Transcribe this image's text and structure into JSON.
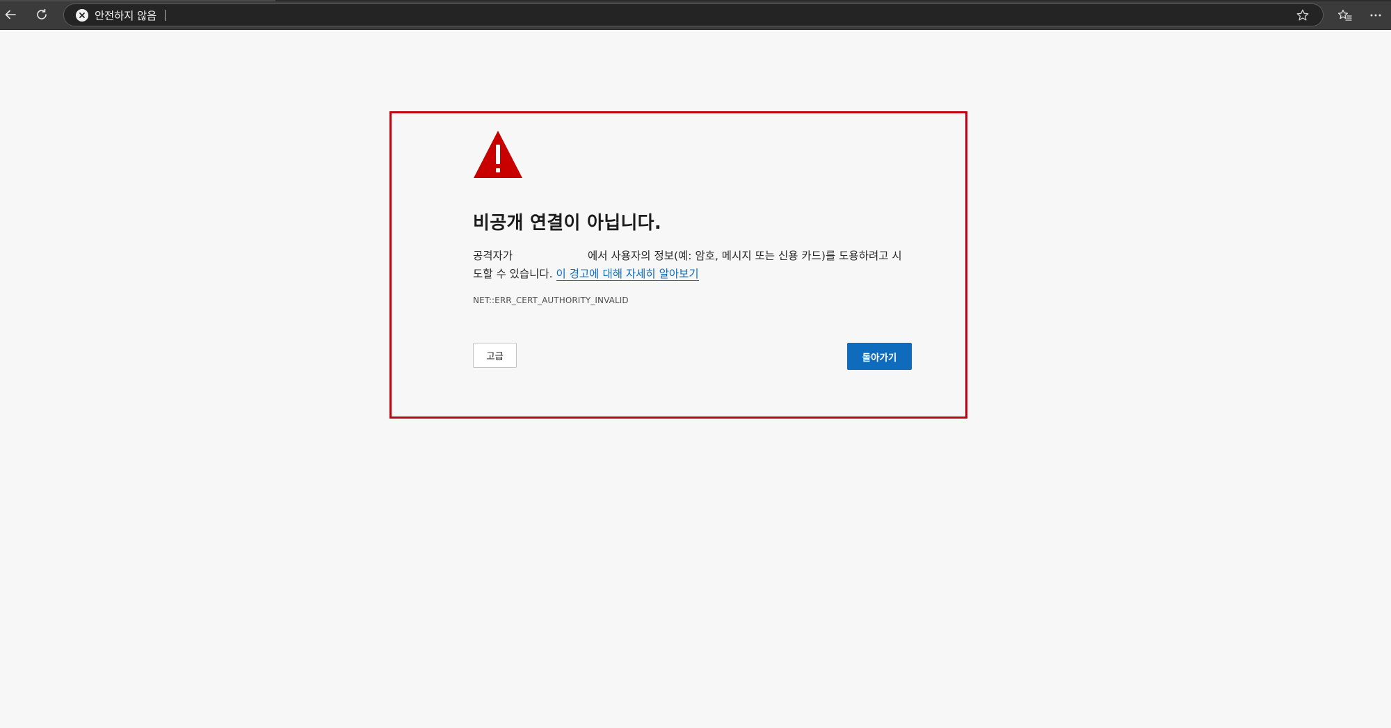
{
  "browser": {
    "security_label": "안전하지 않음",
    "url": ""
  },
  "icons": {
    "back": "back-arrow-icon",
    "refresh": "refresh-icon",
    "security": "close-circle-icon",
    "favorite": "star-icon",
    "favorites_list": "favorites-list-icon",
    "menu": "more-horizontal-icon",
    "warning": "warning-triangle-icon"
  },
  "colors": {
    "warning_red": "#c90000",
    "highlight_border": "#c3000f",
    "primary_blue": "#0f6cbd",
    "toolbar_bg": "#3b3b3b"
  },
  "error_page": {
    "title": "비공개 연결이 아닙니다.",
    "message_prefix": "공격자가",
    "message_suffix": "에서 사용자의 정보(예: 암호, 메시지 또는 신용 카드)를 도용하려고 시도할 수 있습니다.",
    "learn_more_link": "이 경고에 대해 자세히 알아보기",
    "error_code": "NET::ERR_CERT_AUTHORITY_INVALID",
    "advanced_button": "고급",
    "back_button": "돌아가기"
  }
}
